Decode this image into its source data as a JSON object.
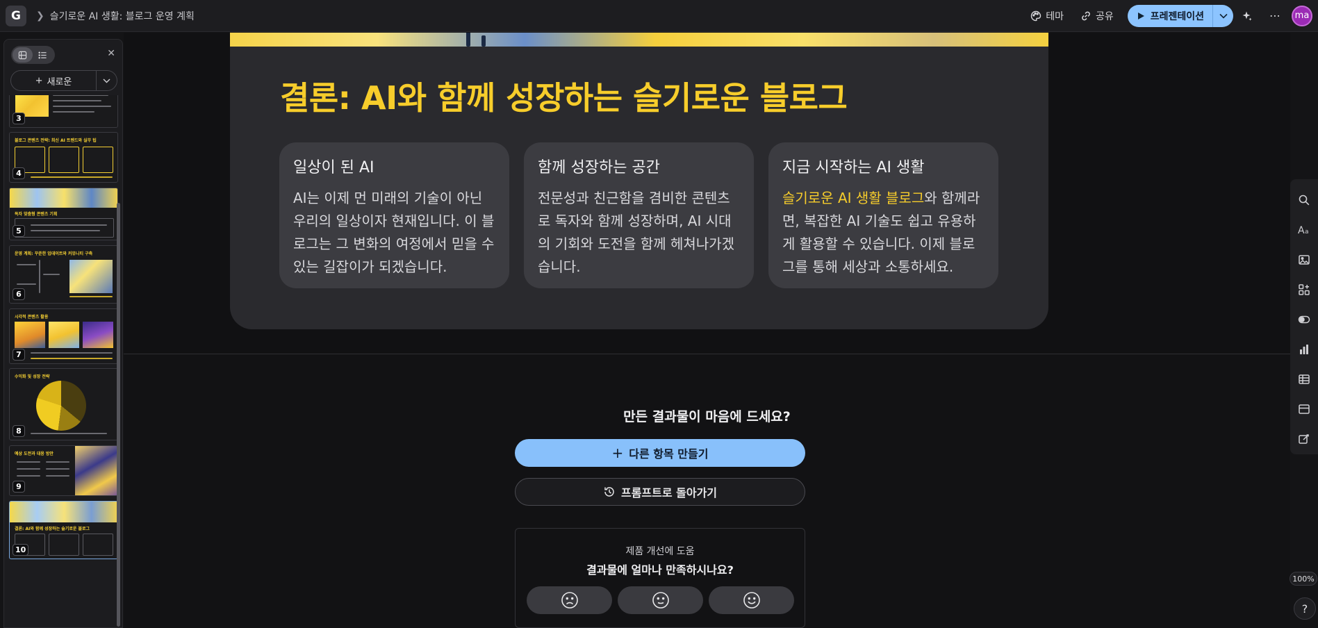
{
  "header": {
    "logo": "G",
    "doc_title": "슬기로운 AI 생활: 블로그 운영 계획",
    "theme_label": "테마",
    "share_label": "공유",
    "present_label": "프레젠테이션",
    "avatar_initials": "ma"
  },
  "left_panel": {
    "new_label": "새로운",
    "thumbnails": [
      {
        "num": "3"
      },
      {
        "num": "4",
        "title": "블로그 콘텐츠 전략: 최신 AI 트렌드와 실무 팁"
      },
      {
        "num": "5",
        "title": "독자 맞춤형 콘텐츠 기획"
      },
      {
        "num": "6",
        "title": "운영 계획: 꾸준한 업데이트와 커뮤니티 구축"
      },
      {
        "num": "7",
        "title": "시각적 콘텐츠 활용"
      },
      {
        "num": "8",
        "title": "수익화 및 성장 전략"
      },
      {
        "num": "9",
        "title": "예상 도전과 대응 방안"
      },
      {
        "num": "10",
        "title": "결론: AI와 함께 성장하는 슬기로운 블로그"
      }
    ]
  },
  "slide": {
    "title": "결론: AI와 함께 성장하는 슬기로운 블로그",
    "cards": [
      {
        "heading": "일상이 된 AI",
        "body": "AI는 이제 먼 미래의 기술이 아닌 우리의 일상이자 현재입니다. 이 블로그는 그 변화의 여정에서 믿을 수 있는 길잡이가 되겠습니다."
      },
      {
        "heading": "함께 성장하는 공간",
        "body": "전문성과 친근함을 겸비한 콘텐츠로 독자와 함께 성장하며, AI 시대의 기회와 도전을 함께 헤쳐나가겠습니다."
      },
      {
        "heading": "지금 시작하는 AI 생활",
        "highlight": "슬기로운 AI 생활 블로그",
        "body": "와 함께라면, 복잡한 AI 기술도 쉽고 유용하게 활용할 수 있습니다. 이제 블로그를 통해 세상과 소통하세요."
      }
    ]
  },
  "feedback": {
    "question": "만든 결과물이 마음에 드세요?",
    "primary_label": "다른 항목 만들기",
    "secondary_label": "프롬프트로 돌아가기",
    "survey_caption": "제품 개선에 도움",
    "survey_question": "결과물에 얼마나 만족하시나요?"
  },
  "zoom": "100%",
  "help": "?",
  "colors": {
    "accent_yellow": "#f7cd2b",
    "primary_blue": "#88c0fb",
    "avatar_purple": "#9b2bb5"
  }
}
